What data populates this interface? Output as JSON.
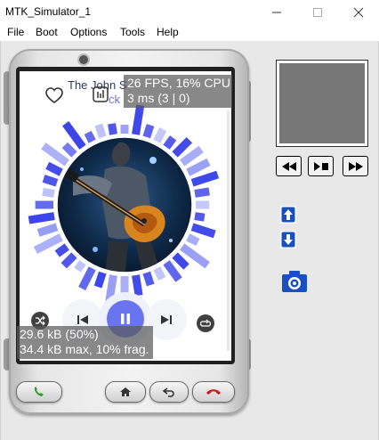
{
  "window": {
    "title": "MTK_Simulator_1",
    "menu": [
      "File",
      "Boot",
      "Options",
      "Tools",
      "Help"
    ]
  },
  "player": {
    "track_title": "The John S",
    "track_subtitle": "ck"
  },
  "overlays": {
    "fps_line1": "26 FPS, 16% CPU",
    "fps_line2": "3 ms (3 | 0)",
    "mem_line1": "29.6 kB (50%)",
    "mem_line2": "34.4 kB max, 10% frag."
  },
  "colors": {
    "accent": "#6a73f0",
    "bars_light": "#c9cdfb",
    "bars_dark": "#3d46e8",
    "camera_blue": "#1a4fc0",
    "call_green": "#2f9e2f",
    "end_red": "#d01616"
  },
  "icons": {
    "shuffle": "shuffle-icon",
    "prev": "skip-previous-icon",
    "pause": "pause-icon",
    "next": "skip-next-icon",
    "repeat": "repeat-icon",
    "heart": "heart-icon",
    "chart": "bar-chart-icon"
  }
}
